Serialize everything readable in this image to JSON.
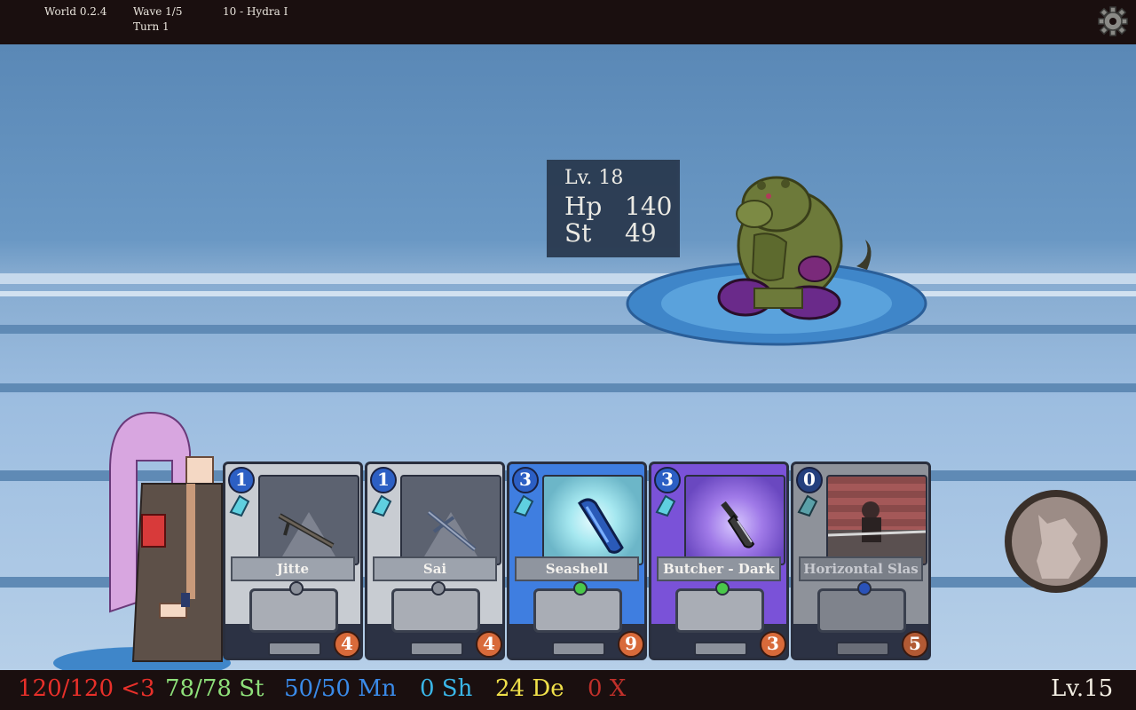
{
  "top": {
    "world": "World 0.2.4",
    "wave": "Wave 1/5",
    "turn": "Turn 1",
    "stage": "10 - Hydra I",
    "settings_icon": "gear-icon"
  },
  "enemy": {
    "level": "Lv. 18",
    "hp_label": "Hp",
    "hp_value": "140",
    "st_label": "St",
    "st_value": "49"
  },
  "cards": [
    {
      "name": "Jitte",
      "cost": "1",
      "value": "4",
      "theme": "gray",
      "gem": "gray"
    },
    {
      "name": "Sai",
      "cost": "1",
      "value": "4",
      "theme": "gray",
      "gem": "gray"
    },
    {
      "name": "Seashell",
      "cost": "3",
      "value": "9",
      "theme": "blue",
      "gem": "green"
    },
    {
      "name": "Butcher - Dark",
      "cost": "3",
      "value": "3",
      "theme": "purple",
      "gem": "green"
    },
    {
      "name": "Horizontal Slas",
      "cost": "0",
      "value": "5",
      "theme": "gray",
      "gem": "blue"
    }
  ],
  "status": {
    "hp": "120/120 <3",
    "st": "78/78 St",
    "mn": "50/50 Mn",
    "sh": "0 Sh",
    "de": "24 De",
    "x": "0 X",
    "level": "Lv.15"
  },
  "colors": {
    "hp": "#e8302a",
    "st": "#8ee07a",
    "mn": "#3a8ae8",
    "sh": "#3ab6e8",
    "de": "#f0e04a",
    "x": "#c0302a",
    "level": "#f2ede2"
  }
}
